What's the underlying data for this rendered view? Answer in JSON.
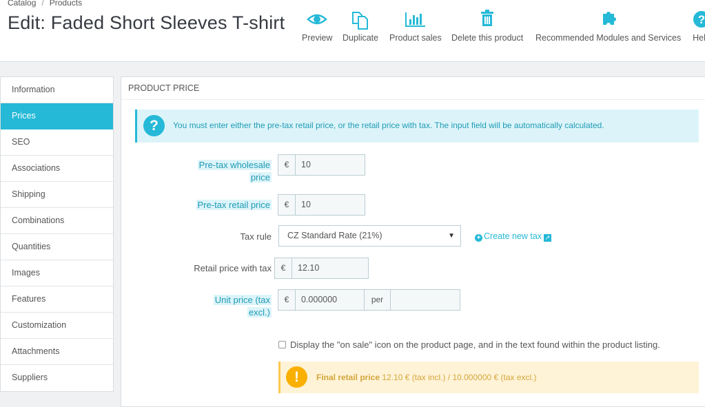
{
  "breadcrumb": {
    "catalog": "Catalog",
    "sep": "/",
    "products": "Products"
  },
  "page_title": "Edit: Faded Short Sleeves T-shirt",
  "toolbar": {
    "preview": "Preview",
    "duplicate": "Duplicate",
    "product_sales": "Product sales",
    "delete": "Delete this product",
    "modules": "Recommended Modules and Services",
    "help": "Help"
  },
  "tabs": [
    "Information",
    "Prices",
    "SEO",
    "Associations",
    "Shipping",
    "Combinations",
    "Quantities",
    "Images",
    "Features",
    "Customization",
    "Attachments",
    "Suppliers"
  ],
  "active_tab": "Prices",
  "panel": {
    "heading": "Product price",
    "info_text": "You must enter either the pre-tax retail price, or the retail price with tax. The input field will be automatically calculated.",
    "currency": "€",
    "wholesale_label_1": "Pre-tax wholesale",
    "wholesale_label_2": "price",
    "wholesale_value": "10",
    "retail_label": "Pre-tax retail price",
    "retail_value": "10",
    "tax_rule_label": "Tax rule",
    "tax_rule_value": "CZ Standard Rate (21%)",
    "create_tax": "Create new tax",
    "retail_tax_label": "Retail price with tax",
    "retail_tax_value": "12.10",
    "unit_label_1": "Unit price (tax",
    "unit_label_2": "excl.)",
    "unit_value": "0.000000",
    "per": "per",
    "unit_per_value": "",
    "on_sale_text": "Display the \"on sale\" icon on the product page, and in the text found within the product listing.",
    "final_label": "Final retail price",
    "final_text": "12.10 € (tax incl.) / 10.000000 € (tax excl.)"
  },
  "colors": {
    "accent": "#25b9d7",
    "warning": "#fab000"
  }
}
